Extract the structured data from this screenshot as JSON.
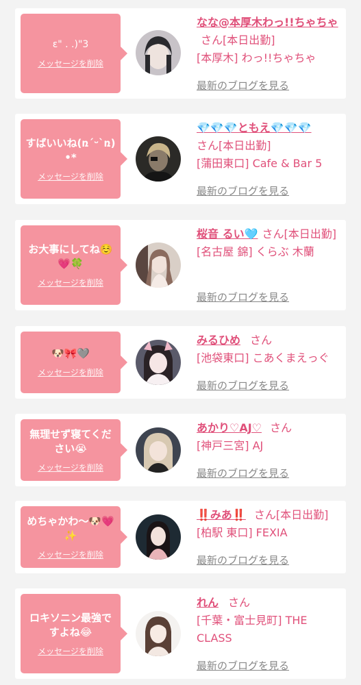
{
  "delete_label": "メッセージを削除",
  "blog_label": "最新のブログを見る",
  "san": "さん",
  "items": [
    {
      "message": "ε\" . .)\"3",
      "name": "なな@本厚木わっ!!ちゃちゃ",
      "badge": "[本日出勤]",
      "shop": "[本厚木] わっ!!ちゃちゃ"
    },
    {
      "message": "すばいいね(ռ´ᵕ`ռ)•*",
      "name": "💎💎💎ともえ💎💎💎",
      "badge": "[本日出勤]",
      "shop": "[蒲田東口] Cafe & Bar 5"
    },
    {
      "message": "お大事にしてね☺️💗🍀",
      "name": "桜音 るい🩵",
      "badge": "[本日出勤]",
      "shop": "[名古屋 錦] くらぶ 木蘭"
    },
    {
      "message": "🐶🎀🩶",
      "name": "みるひめ",
      "badge": "",
      "shop": "[池袋東口] こあくまえっぐ"
    },
    {
      "message": "無理せず寝てください😭",
      "name": "あかり♡AJ♡",
      "badge": "",
      "shop": "[神戸三宮] AJ"
    },
    {
      "message": "めちゃかわ〜🐶💗✨",
      "name": "‼️みあ‼️",
      "badge": "[本日出勤]",
      "shop": "[柏駅 東口] FEXIA"
    },
    {
      "message": "ロキソニン最強ですよね😂",
      "name": "れん",
      "badge": "",
      "shop": "[千葉・富士見町] THE CLASS"
    }
  ]
}
